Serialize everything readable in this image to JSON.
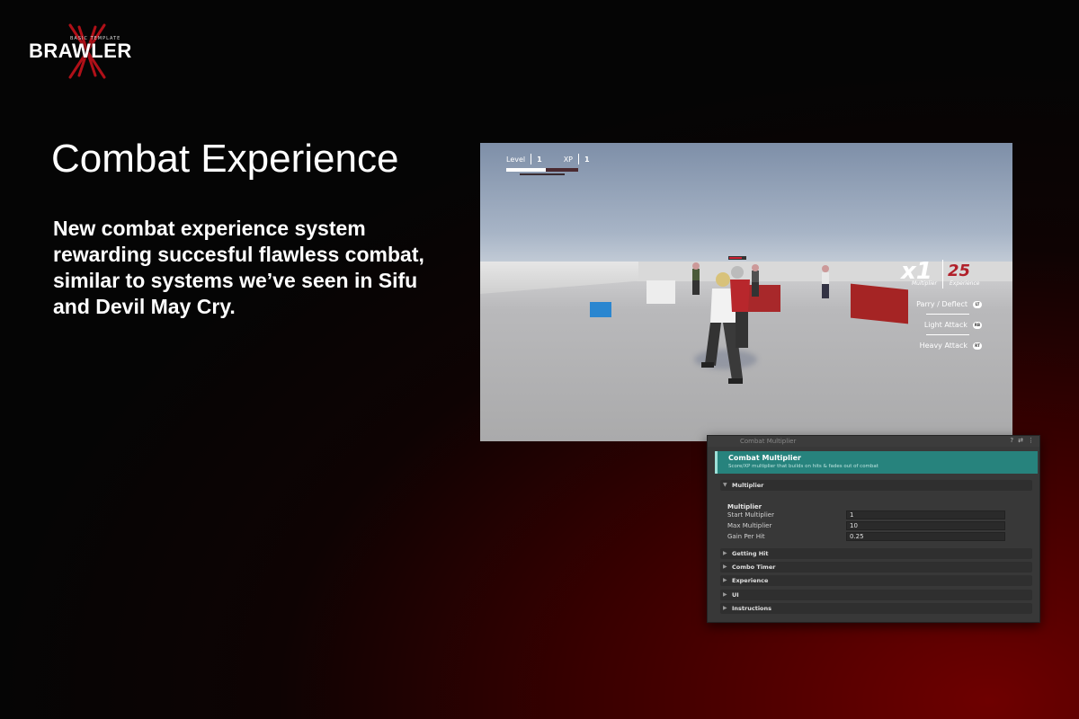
{
  "logo": {
    "word": "BRAWLER",
    "sub": "BASIC TEMPLATE"
  },
  "headline": "Combat Experience",
  "body": "New combat experience system rewarding succesful flawless combat, similar to systems we’ve seen in Sifu and Devil May Cry.",
  "hud": {
    "level_label": "Level",
    "level_value": "1",
    "xp_label": "XP",
    "xp_value": "1",
    "xp_progress": 0.55,
    "multiplier": "x1",
    "multiplier_label": "Multiplier",
    "experience": "25",
    "experience_label": "Experience",
    "actions": [
      {
        "label": "Parry / Deflect",
        "key": "LT"
      },
      {
        "label": "Light Attack",
        "key": "RB"
      },
      {
        "label": "Heavy Attack",
        "key": "RT"
      }
    ]
  },
  "inspector": {
    "header_title": "Combat Multiplier",
    "banner_title": "Combat Multiplier",
    "banner_subtitle": "Score/XP multiplier that builds on hits & fades out of combat",
    "sections": [
      "Multiplier",
      "Getting Hit",
      "Combo Timer",
      "Experience",
      "UI",
      "Instructions"
    ],
    "group_label": "Multiplier",
    "fields": [
      {
        "label": "Start Multiplier",
        "value": "1"
      },
      {
        "label": "Max Multiplier",
        "value": "10"
      },
      {
        "label": "Gain Per Hit",
        "value": "0.25"
      }
    ]
  },
  "colors": {
    "accent_teal": "#27837d",
    "score_red": "#b1202a",
    "bg_red": "#6e0000"
  }
}
